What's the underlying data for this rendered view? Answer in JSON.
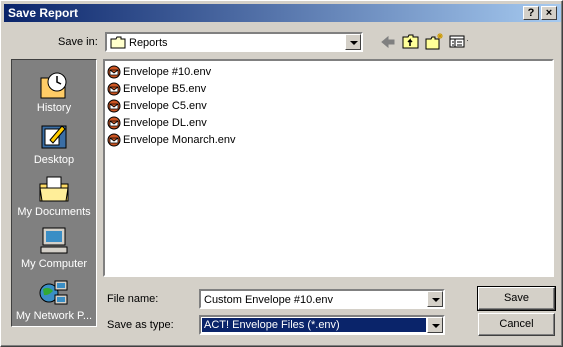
{
  "window": {
    "title": "Save Report",
    "help_label": "?",
    "close_label": "×"
  },
  "save_in": {
    "label": "Save in:",
    "value": "Reports"
  },
  "toolbar": {
    "back_icon": "back-arrow-icon",
    "up_icon": "up-folder-icon",
    "new_folder_icon": "new-folder-icon",
    "view_menu_icon": "view-menu-icon"
  },
  "places": [
    {
      "label": "History",
      "icon": "history-icon"
    },
    {
      "label": "Desktop",
      "icon": "desktop-icon"
    },
    {
      "label": "My Documents",
      "icon": "my-documents-icon"
    },
    {
      "label": "My Computer",
      "icon": "my-computer-icon"
    },
    {
      "label": "My Network P...",
      "icon": "my-network-icon"
    }
  ],
  "files": [
    {
      "name": "Envelope #10.env"
    },
    {
      "name": "Envelope B5.env"
    },
    {
      "name": "Envelope C5.env"
    },
    {
      "name": "Envelope DL.env"
    },
    {
      "name": "Envelope Monarch.env"
    }
  ],
  "file_name": {
    "label": "File name:",
    "value": "Custom Envelope #10.env"
  },
  "save_as_type": {
    "label": "Save as type:",
    "value": "ACT! Envelope Files (*.env)"
  },
  "buttons": {
    "save": "Save",
    "cancel": "Cancel"
  },
  "colors": {
    "titlebar_start": "#0a246a",
    "titlebar_end": "#a6caf0",
    "selection": "#0a246a",
    "face": "#d4d0c8"
  }
}
